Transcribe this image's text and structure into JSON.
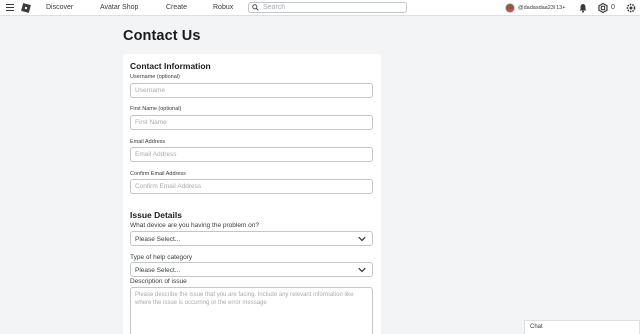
{
  "topbar": {
    "nav": [
      "Discover",
      "Avatar Shop",
      "Create",
      "Robux"
    ],
    "search_placeholder": "Search",
    "username": "@dadasdaa23l",
    "username_suffix": "13+",
    "robux": "0"
  },
  "page": {
    "title": "Contact Us"
  },
  "contact_info": {
    "heading": "Contact Information",
    "fields": [
      {
        "label": "Username (optional)",
        "placeholder": "Username"
      },
      {
        "label": "First Name (optional)",
        "placeholder": "First Name"
      },
      {
        "label": "Email Address",
        "placeholder": "Email Address"
      },
      {
        "label": "Confirm Email Address",
        "placeholder": "Confirm Email Address"
      }
    ]
  },
  "issue_details": {
    "heading": "Issue Details",
    "device_label": "What device are you having the problem on?",
    "device_value": "Please Select...",
    "category_label": "Type of help category",
    "category_value": "Please Select...",
    "description_label": "Description of issue",
    "description_placeholder": "Please describe the issue that you are facing. Include any relevant information like where the issue is occurring or the error message"
  },
  "chat": {
    "label": "Chat"
  }
}
